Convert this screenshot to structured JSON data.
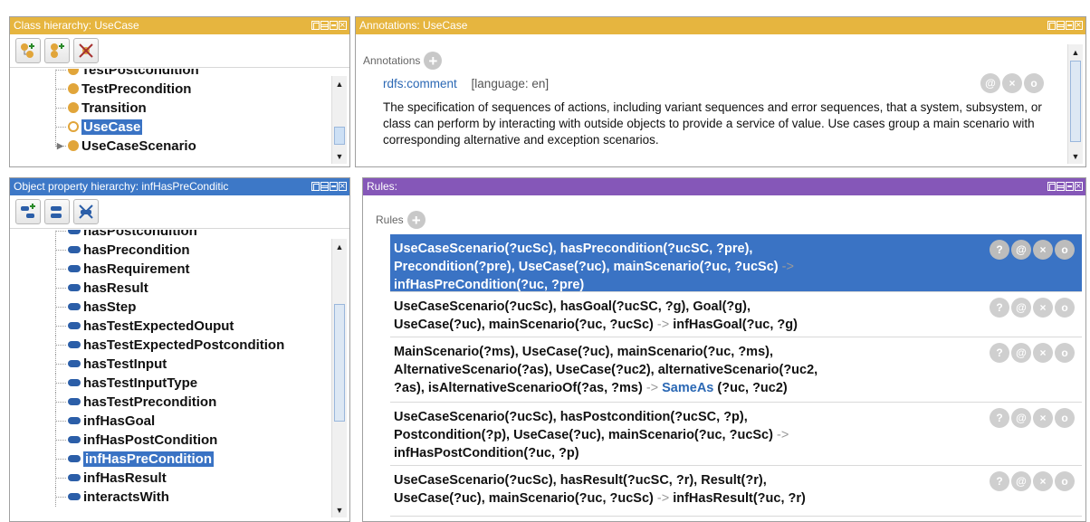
{
  "class_panel": {
    "title": "Class hierarchy: UseCase",
    "toolbar": [
      "add-subclass-icon",
      "add-sibling-icon",
      "delete-class-icon"
    ],
    "items": [
      {
        "label": "TestPostcondition"
      },
      {
        "label": "TestPrecondition"
      },
      {
        "label": "Transition"
      },
      {
        "label": "UseCase",
        "selected": true
      },
      {
        "label": "UseCaseScenario",
        "expandable": true
      }
    ]
  },
  "annotations_panel": {
    "title": "Annotations: UseCase",
    "section_label": "Annotations",
    "property": "rdfs:comment",
    "language": "[language: en]",
    "text": "The specification of sequences of actions, including variant sequences and error sequences, that a system, subsystem, or class can perform by interacting with outside objects to provide a service of value. Use cases group a main scenario with corresponding alternative and exception scenarios."
  },
  "objprop_panel": {
    "title": "Object property hierarchy: infHasPreConditic",
    "items": [
      {
        "label": "hasPostcondition"
      },
      {
        "label": "hasPrecondition"
      },
      {
        "label": "hasRequirement"
      },
      {
        "label": "hasResult"
      },
      {
        "label": "hasStep"
      },
      {
        "label": "hasTestExpectedOuput"
      },
      {
        "label": "hasTestExpectedPostcondition"
      },
      {
        "label": "hasTestInput"
      },
      {
        "label": "hasTestInputType"
      },
      {
        "label": "hasTestPrecondition"
      },
      {
        "label": "infHasGoal"
      },
      {
        "label": "infHasPostCondition"
      },
      {
        "label": "infHasPreCondition",
        "selected": true
      },
      {
        "label": "infHasResult"
      },
      {
        "label": "interactsWith"
      }
    ]
  },
  "rules_panel": {
    "title": "Rules:",
    "section_label": "Rules",
    "rules": [
      {
        "selected": true,
        "lines": [
          "UseCaseScenario(?ucSc), hasPrecondition(?ucSC, ?pre),",
          "Precondition(?pre), UseCase(?uc), mainScenario(?uc, ?ucSc) ->",
          "infHasPreCondition(?uc, ?pre)"
        ]
      },
      {
        "lines": [
          "UseCaseScenario(?ucSc), hasGoal(?ucSC, ?g), Goal(?g),",
          "UseCase(?uc), mainScenario(?uc, ?ucSc) -> infHasGoal(?uc, ?g)"
        ]
      },
      {
        "lines": [
          "MainScenario(?ms), UseCase(?uc), mainScenario(?uc, ?ms),",
          "AlternativeScenario(?as), UseCase(?uc2), alternativeScenario(?uc2,",
          "?as), isAlternativeScenarioOf(?as, ?ms) -> SameAs (?uc, ?uc2)"
        ]
      },
      {
        "lines": [
          "UseCaseScenario(?ucSc), hasPostcondition(?ucSC, ?p),",
          "Postcondition(?p), UseCase(?uc), mainScenario(?uc, ?ucSc) ->",
          "infHasPostCondition(?uc, ?p)"
        ]
      },
      {
        "lines": [
          "UseCaseScenario(?ucSc), hasResult(?ucSC, ?r), Result(?r),",
          "UseCase(?uc), mainScenario(?uc, ?ucSc) -> infHasResult(?uc, ?r)"
        ]
      }
    ],
    "row_buttons": [
      "?",
      "@",
      "×",
      "o"
    ]
  },
  "colors": {
    "gold_title": "#e6b53f",
    "purple_title": "#8557b8",
    "selection": "#3a73c4",
    "class_dot": "#e1a53a",
    "property_bar": "#2b5ea8"
  }
}
